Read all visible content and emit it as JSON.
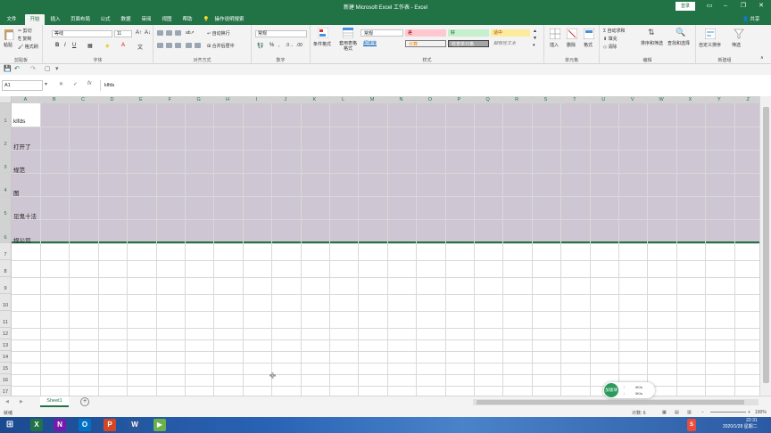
{
  "window": {
    "title": "新建 Microsoft Excel 工作表 - Excel",
    "login_label": "登录"
  },
  "tabs": [
    {
      "label": "文件"
    },
    {
      "label": "开始"
    },
    {
      "label": "插入"
    },
    {
      "label": "页面布局"
    },
    {
      "label": "公式"
    },
    {
      "label": "数据"
    },
    {
      "label": "审阅"
    },
    {
      "label": "视图"
    },
    {
      "label": "帮助"
    },
    {
      "label": "操作说明搜索"
    }
  ],
  "share_label": "共享",
  "ribbon": {
    "clipboard": {
      "group": "剪贴板",
      "paste": "粘贴",
      "cut": "剪切",
      "copy": "复制",
      "format_painter": "格式刷"
    },
    "font": {
      "group": "字体",
      "font_name": "等线",
      "font_size": "11",
      "bold": "B",
      "italic": "I",
      "underline": "U"
    },
    "alignment": {
      "group": "对齐方式",
      "wrap_text": "自动换行",
      "merge_center": "合并后居中"
    },
    "number": {
      "group": "数字",
      "format": "常规"
    },
    "styles": {
      "group": "样式",
      "conditional_format": "条件格式",
      "table_format": "套用表格格式",
      "cells": [
        {
          "label": "常规"
        },
        {
          "label": "差"
        },
        {
          "label": "好"
        },
        {
          "label": "适中"
        },
        {
          "label": "超链接"
        },
        {
          "label": "计算"
        },
        {
          "label": "检查单元格"
        },
        {
          "label": "解释性文本"
        }
      ]
    },
    "cells_group": {
      "group": "单元格",
      "insert": "插入",
      "delete": "删除",
      "format": "格式"
    },
    "editing": {
      "group": "编辑",
      "autosum": "自动求和",
      "fill": "填充",
      "clear": "清除",
      "sort_filter": "排序和筛选",
      "find_select": "查找和选择"
    },
    "new_group": {
      "group": "新建组",
      "custom_sort": "自定义排序",
      "filter": "筛选"
    }
  },
  "formula_bar": {
    "name_box": "A1",
    "fx": "fx",
    "value": "klfds"
  },
  "columns": [
    "A",
    "B",
    "C",
    "D",
    "E",
    "F",
    "G",
    "H",
    "I",
    "J",
    "K",
    "L",
    "M",
    "N",
    "O",
    "P",
    "Q",
    "R",
    "S",
    "T",
    "U",
    "V",
    "W",
    "X",
    "Y",
    "Z"
  ],
  "rows": [
    {
      "num": "1",
      "a": "klfds"
    },
    {
      "num": "2",
      "a": "打开了"
    },
    {
      "num": "3",
      "a": "规范"
    },
    {
      "num": "4",
      "a": "图"
    },
    {
      "num": "5",
      "a": "见鬼十法"
    },
    {
      "num": "6",
      "a": "规公司"
    },
    {
      "num": "7",
      "a": ""
    },
    {
      "num": "8",
      "a": ""
    },
    {
      "num": "9",
      "a": ""
    },
    {
      "num": "10",
      "a": ""
    },
    {
      "num": "11",
      "a": ""
    },
    {
      "num": "12",
      "a": ""
    },
    {
      "num": "13",
      "a": ""
    },
    {
      "num": "14",
      "a": ""
    },
    {
      "num": "15",
      "a": ""
    },
    {
      "num": "16",
      "a": ""
    },
    {
      "num": "17",
      "a": ""
    },
    {
      "num": "18",
      "a": ""
    },
    {
      "num": "19",
      "a": ""
    }
  ],
  "sheet": {
    "name": "Sheet1"
  },
  "status": {
    "ready": "就绪",
    "count": "计数: 6",
    "zoom": "100%"
  },
  "widget": {
    "label": "加速球",
    "up": "0K/s",
    "down": "0K/s",
    "up_mark": "↑",
    "down_mark": "↓"
  },
  "taskbar": {
    "time": "22:31",
    "date": "2020/1/28 星期二"
  },
  "colors": {
    "excel_green": "#217346",
    "selection": "#cec6d2"
  }
}
